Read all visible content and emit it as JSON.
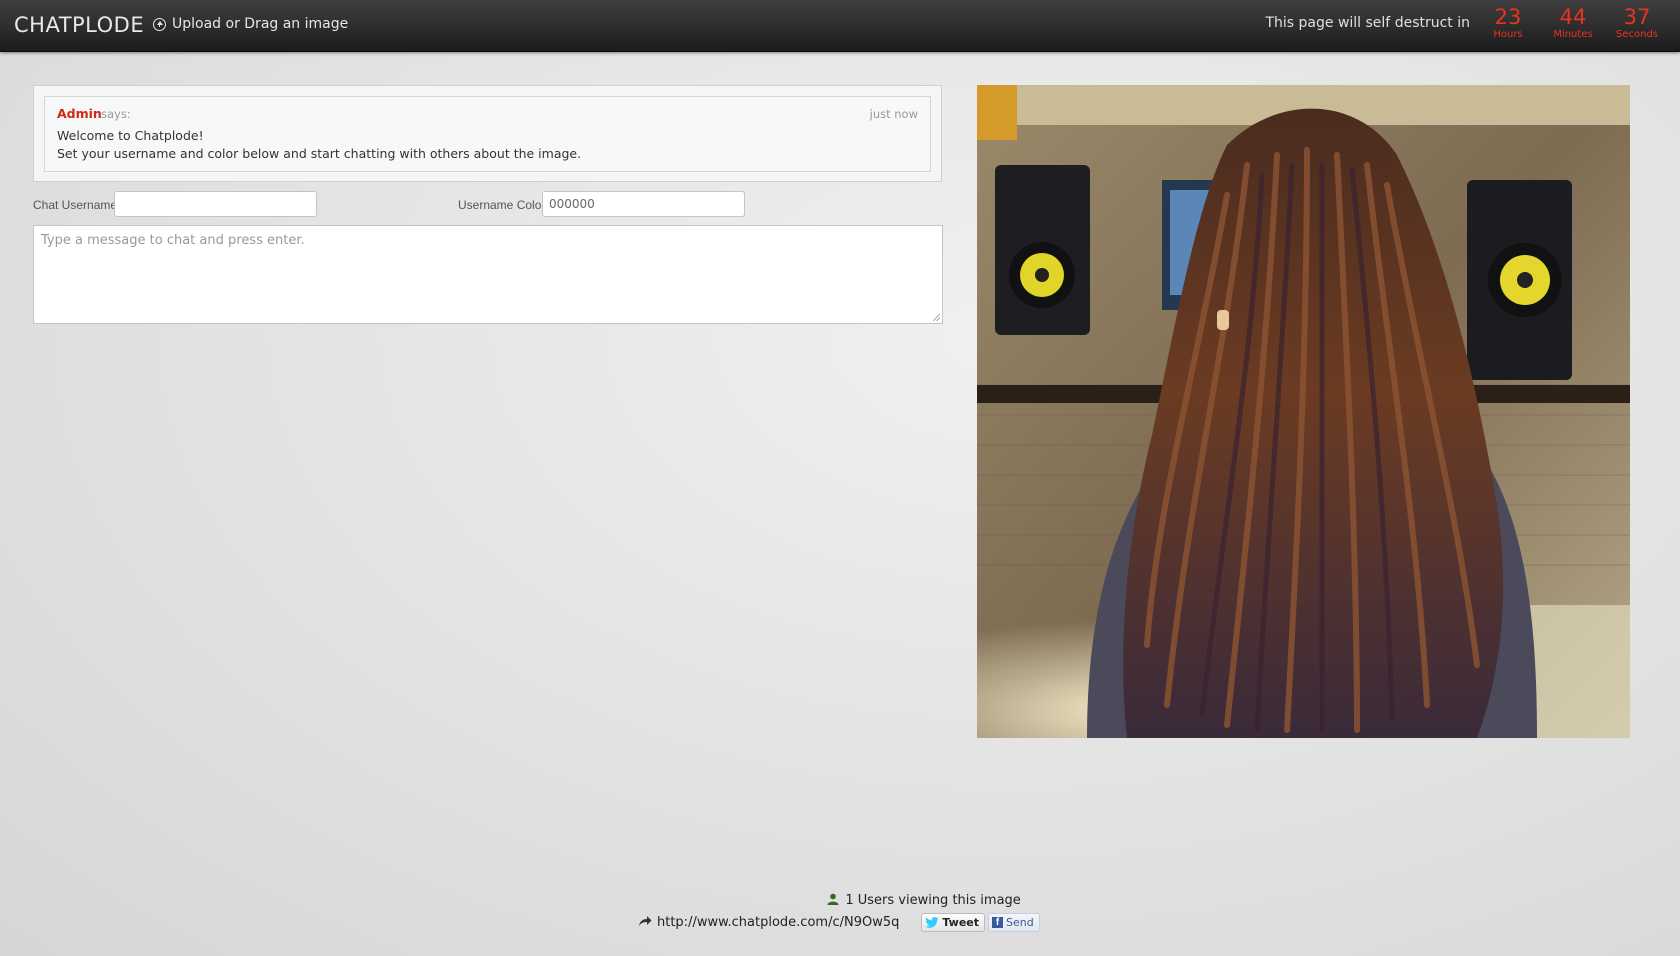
{
  "header": {
    "brand": "CHATPLODE",
    "upload_label": "Upload or Drag an image",
    "destruct_text": "This page will self destruct in",
    "countdown": [
      {
        "value": "23",
        "unit": "Hours"
      },
      {
        "value": "44",
        "unit": "Minutes"
      },
      {
        "value": "37",
        "unit": "Seconds"
      }
    ]
  },
  "chat": {
    "message": {
      "user": "Admin",
      "says": "says:",
      "time": "just now",
      "lines": [
        "Welcome to Chatplode!",
        "Set your username and color below and start chatting with others about the image."
      ]
    },
    "username_label": "Chat Username",
    "username_value": "",
    "color_label": "Username Color",
    "color_value": "000000",
    "message_placeholder": "Type a message to chat and press enter."
  },
  "footer": {
    "viewers_text": "1 Users viewing this image",
    "share_url": "http://www.chatplode.com/c/N9Ow5q",
    "tweet_label": "Tweet",
    "send_label": "Send"
  },
  "colors": {
    "accent_red": "#e8341c",
    "admin_red": "#cc2a12",
    "topbar": "#2a2a2a",
    "twitter_blue": "#33ccff",
    "facebook_blue": "#3b5998"
  }
}
